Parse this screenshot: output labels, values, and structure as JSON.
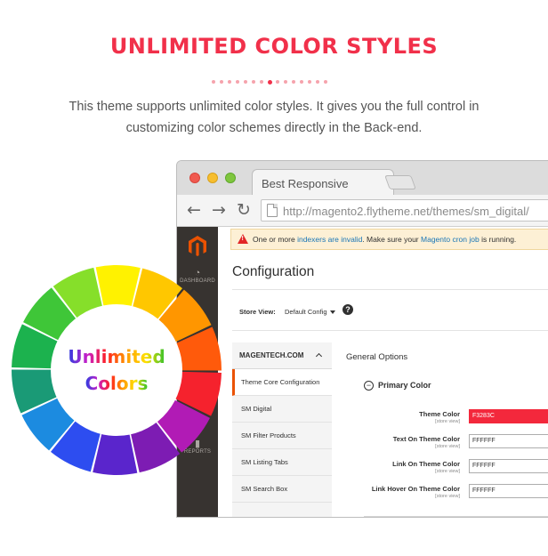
{
  "hero": {
    "title": "UNLIMITED COLOR STYLES",
    "text": "This theme supports unlimited color styles. It gives you the full control in customizing color schemes directly in the Back-end."
  },
  "browser": {
    "tab_title": "Best Responsive",
    "url": "http://magento2.flytheme.net/themes/sm_digital/",
    "nav_icons": [
      "back-arrow-icon",
      "forward-arrow-icon",
      "reload-icon"
    ]
  },
  "admin": {
    "sidebar": [
      {
        "label": "DASHBOARD",
        "icon": "dashboard-icon"
      },
      {
        "label": "REPORTS",
        "icon": "reports-icon"
      }
    ],
    "notice": {
      "prefix": "One or more",
      "link1": "indexers are invalid",
      "middle": ". Make sure your",
      "link2": "Magento cron job",
      "suffix": "is running."
    },
    "page_title": "Configuration",
    "store_view_label": "Store View:",
    "store_view_value": "Default Config",
    "left_nav": {
      "header": "MAGENTECH.COM",
      "items": [
        "Theme Core Configuration",
        "SM Digital",
        "SM Filter Products",
        "SM Listing Tabs",
        "SM Search Box"
      ]
    },
    "section_title": "General Options",
    "group_title": "Primary Color",
    "fields": [
      {
        "label": "Theme Color",
        "scope": "[store view]",
        "value": "F3283C"
      },
      {
        "label": "Text On Theme Color",
        "scope": "[store view]",
        "value": "FFFFFF"
      },
      {
        "label": "Link On Theme Color",
        "scope": "[store view]",
        "value": "FFFFFF"
      },
      {
        "label": "Link Hover On Theme Color",
        "scope": "[store view]",
        "value": "FFFFFF"
      }
    ]
  },
  "wheel": {
    "line1": "Unlimited",
    "line2": "Colors",
    "segment_colors": [
      "#fff200",
      "#ffc700",
      "#ff9600",
      "#ff5a0b",
      "#f5222d",
      "#b11bb5",
      "#7d1cb3",
      "#5a25cc",
      "#2d4df0",
      "#1c8be0",
      "#1a9a76",
      "#1cb24e",
      "#3fc638",
      "#86df2a"
    ]
  },
  "colors": {
    "accent": "#f1304a",
    "theme_color": "#f3283c",
    "admin_active": "#eb5202"
  }
}
